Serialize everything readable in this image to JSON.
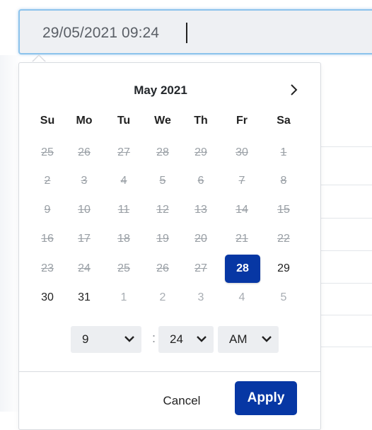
{
  "input": {
    "value": "29/05/2021 09:24"
  },
  "calendar": {
    "month_label": "May 2021",
    "next_icon": "chevron-right-icon",
    "weekdays": [
      "Su",
      "Mo",
      "Tu",
      "We",
      "Th",
      "Fr",
      "Sa"
    ],
    "weeks": [
      [
        {
          "d": "25",
          "s": "disabled"
        },
        {
          "d": "26",
          "s": "disabled"
        },
        {
          "d": "27",
          "s": "disabled"
        },
        {
          "d": "28",
          "s": "disabled"
        },
        {
          "d": "29",
          "s": "disabled"
        },
        {
          "d": "30",
          "s": "disabled"
        },
        {
          "d": "1",
          "s": "disabled"
        }
      ],
      [
        {
          "d": "2",
          "s": "disabled"
        },
        {
          "d": "3",
          "s": "disabled"
        },
        {
          "d": "4",
          "s": "disabled"
        },
        {
          "d": "5",
          "s": "disabled"
        },
        {
          "d": "6",
          "s": "disabled"
        },
        {
          "d": "7",
          "s": "disabled"
        },
        {
          "d": "8",
          "s": "disabled"
        }
      ],
      [
        {
          "d": "9",
          "s": "disabled"
        },
        {
          "d": "10",
          "s": "disabled"
        },
        {
          "d": "11",
          "s": "disabled"
        },
        {
          "d": "12",
          "s": "disabled"
        },
        {
          "d": "13",
          "s": "disabled"
        },
        {
          "d": "14",
          "s": "disabled"
        },
        {
          "d": "15",
          "s": "disabled"
        }
      ],
      [
        {
          "d": "16",
          "s": "disabled"
        },
        {
          "d": "17",
          "s": "disabled"
        },
        {
          "d": "18",
          "s": "disabled"
        },
        {
          "d": "19",
          "s": "disabled"
        },
        {
          "d": "20",
          "s": "disabled"
        },
        {
          "d": "21",
          "s": "disabled"
        },
        {
          "d": "22",
          "s": "disabled"
        }
      ],
      [
        {
          "d": "23",
          "s": "disabled"
        },
        {
          "d": "24",
          "s": "disabled"
        },
        {
          "d": "25",
          "s": "disabled"
        },
        {
          "d": "26",
          "s": "disabled"
        },
        {
          "d": "27",
          "s": "disabled"
        },
        {
          "d": "28",
          "s": "selected"
        },
        {
          "d": "29",
          "s": "active"
        }
      ],
      [
        {
          "d": "30",
          "s": "active"
        },
        {
          "d": "31",
          "s": "active"
        },
        {
          "d": "1",
          "s": "muted"
        },
        {
          "d": "2",
          "s": "muted"
        },
        {
          "d": "3",
          "s": "muted"
        },
        {
          "d": "4",
          "s": "muted"
        },
        {
          "d": "5",
          "s": "muted"
        }
      ]
    ]
  },
  "time": {
    "hour": "9",
    "separator": ":",
    "minute": "24",
    "ampm": "AM",
    "dropdown_icon": "chevron-down-icon"
  },
  "actions": {
    "cancel_label": "Cancel",
    "apply_label": "Apply"
  },
  "colors": {
    "accent": "#0737a4",
    "focus_border": "#8cc3ec",
    "disabled_text": "#9aa0a6"
  }
}
